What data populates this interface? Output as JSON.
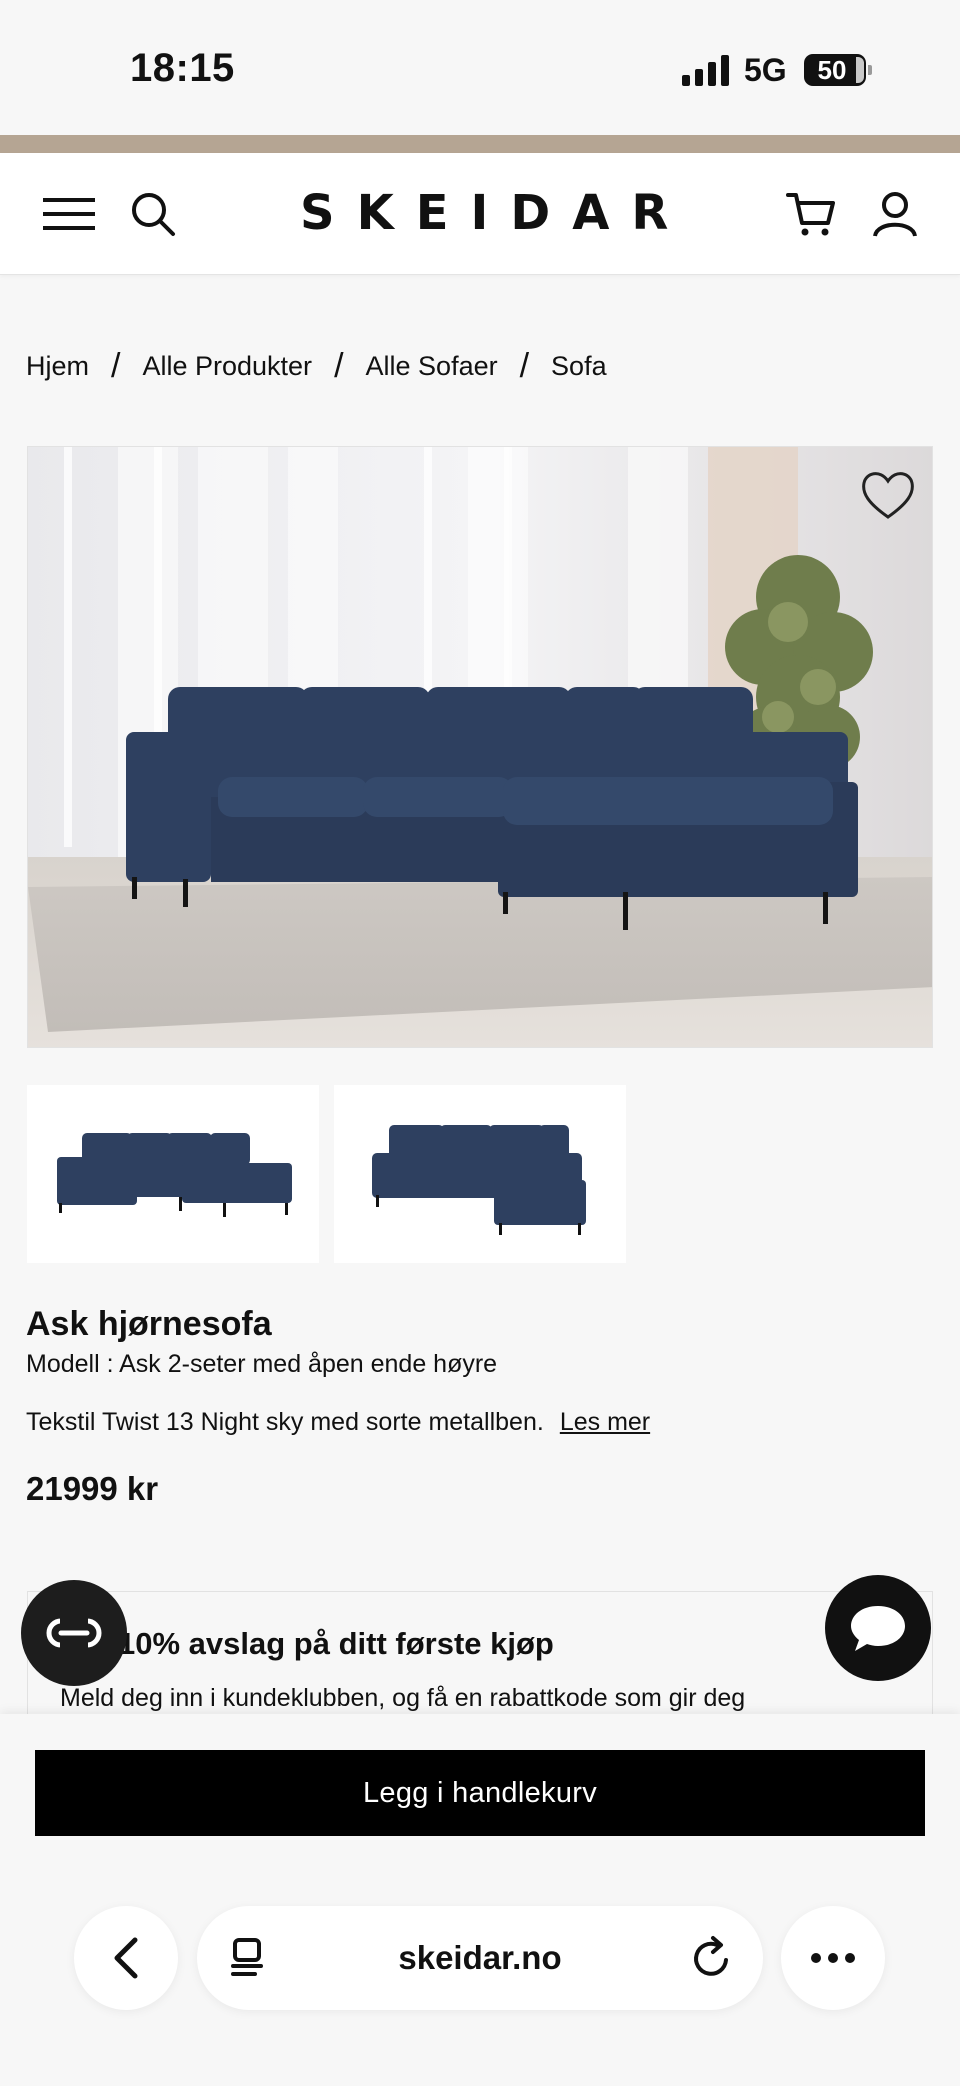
{
  "status": {
    "time": "18:15",
    "network": "5G",
    "battery": "50"
  },
  "header": {
    "logo": "SKEIDAR",
    "brand_color": "#b5a593"
  },
  "breadcrumb": [
    "Hjem",
    "Alle Produkter",
    "Alle Sofaer",
    "Sofa"
  ],
  "breadcrumb_separator": "/",
  "product": {
    "name": "Ask hjørnesofa",
    "model": "Modell : Ask 2-seter med åpen ende høyre",
    "description": "Tekstil Twist 13 Night sky med sorte metallben.",
    "read_more": "Les mer",
    "price": "21999 kr",
    "color": "#2e4060"
  },
  "promo": {
    "title": "10% avslag på ditt første kjøp",
    "text": "Meld deg inn i kundeklubben, og få en rabattkode som gir deg"
  },
  "cart_button": "Legg i handlekurv",
  "browser": {
    "url": "skeidar.no"
  },
  "icons": [
    "menu-icon",
    "search-icon",
    "cart-icon",
    "user-icon",
    "heart-icon",
    "chat-icon",
    "back-icon",
    "tabs-icon",
    "reload-icon",
    "more-icon"
  ]
}
